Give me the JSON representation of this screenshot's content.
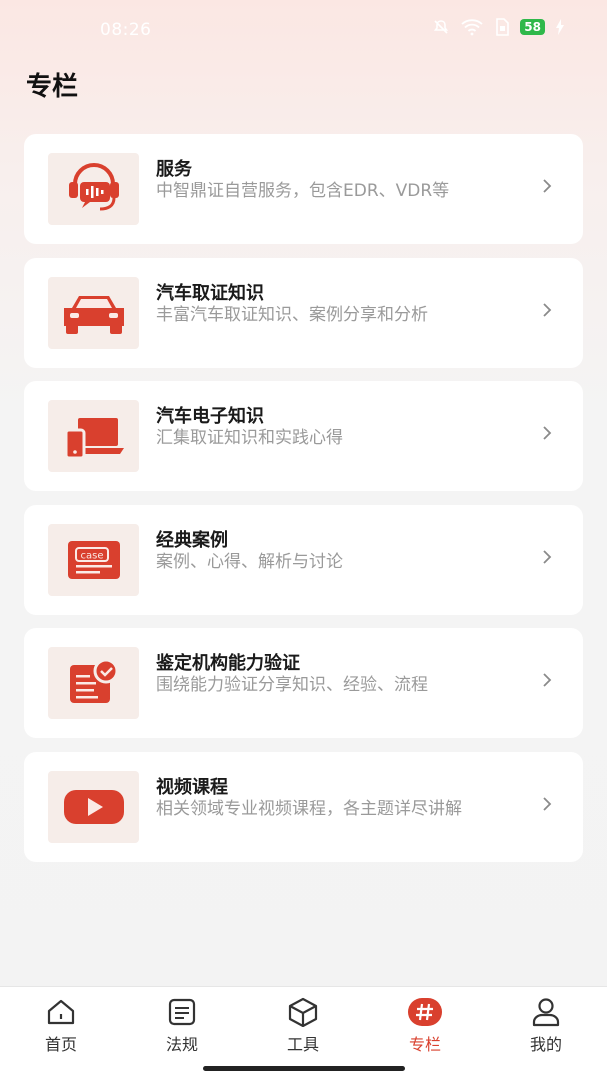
{
  "status_bar": {
    "time": "08:26",
    "battery": "58"
  },
  "page": {
    "title": "专栏"
  },
  "cards": [
    {
      "icon": "headset-icon",
      "title": "服务",
      "desc": "中智鼎证自营服务，包含EDR、VDR等"
    },
    {
      "icon": "car-icon",
      "title": "汽车取证知识",
      "desc": "丰富汽车取证知识、案例分享和分析"
    },
    {
      "icon": "devices-icon",
      "title": "汽车电子知识",
      "desc": "汇集取证知识和实践心得"
    },
    {
      "icon": "case-icon",
      "title": "经典案例",
      "desc": "案例、心得、解析与讨论",
      "icon_text": "case"
    },
    {
      "icon": "certificate-check-icon",
      "title": "鉴定机构能力验证",
      "desc": "围绕能力验证分享知识、经验、流程"
    },
    {
      "icon": "video-play-icon",
      "title": "视频课程",
      "desc": "相关领域专业视频课程，各主题详尽讲解"
    }
  ],
  "bottom_nav": [
    {
      "icon": "home-icon",
      "label": "首页",
      "active": false
    },
    {
      "icon": "regulations-icon",
      "label": "法规",
      "active": false
    },
    {
      "icon": "tools-box-icon",
      "label": "工具",
      "active": false
    },
    {
      "icon": "hashtag-icon",
      "label": "专栏",
      "active": true
    },
    {
      "icon": "profile-icon",
      "label": "我的",
      "active": false
    }
  ],
  "colors": {
    "accent": "#d9402e",
    "icon_bg": "#f6ede9",
    "muted_text": "#9a9a9a"
  }
}
